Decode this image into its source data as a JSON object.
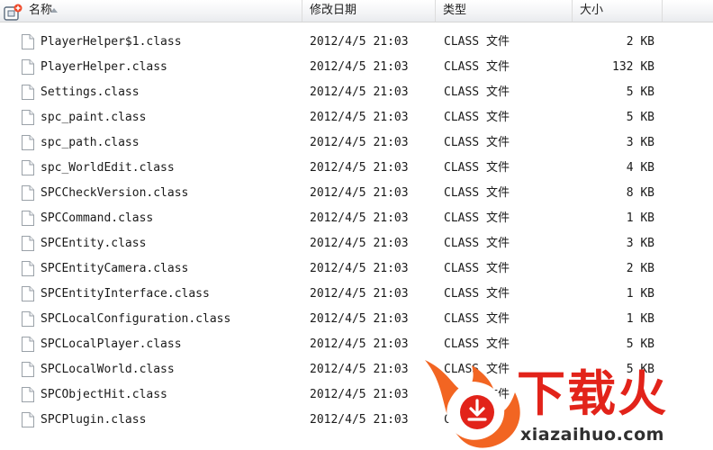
{
  "columns": {
    "name": "名称",
    "date": "修改日期",
    "type": "类型",
    "size": "大小"
  },
  "files": [
    {
      "name": "PlayerHelper$1.class",
      "date": "2012/4/5 21:03",
      "type": "CLASS 文件",
      "size": "2 KB"
    },
    {
      "name": "PlayerHelper.class",
      "date": "2012/4/5 21:03",
      "type": "CLASS 文件",
      "size": "132 KB"
    },
    {
      "name": "Settings.class",
      "date": "2012/4/5 21:03",
      "type": "CLASS 文件",
      "size": "5 KB"
    },
    {
      "name": "spc_paint.class",
      "date": "2012/4/5 21:03",
      "type": "CLASS 文件",
      "size": "5 KB"
    },
    {
      "name": "spc_path.class",
      "date": "2012/4/5 21:03",
      "type": "CLASS 文件",
      "size": "3 KB"
    },
    {
      "name": "spc_WorldEdit.class",
      "date": "2012/4/5 21:03",
      "type": "CLASS 文件",
      "size": "4 KB"
    },
    {
      "name": "SPCCheckVersion.class",
      "date": "2012/4/5 21:03",
      "type": "CLASS 文件",
      "size": "8 KB"
    },
    {
      "name": "SPCCommand.class",
      "date": "2012/4/5 21:03",
      "type": "CLASS 文件",
      "size": "1 KB"
    },
    {
      "name": "SPCEntity.class",
      "date": "2012/4/5 21:03",
      "type": "CLASS 文件",
      "size": "3 KB"
    },
    {
      "name": "SPCEntityCamera.class",
      "date": "2012/4/5 21:03",
      "type": "CLASS 文件",
      "size": "2 KB"
    },
    {
      "name": "SPCEntityInterface.class",
      "date": "2012/4/5 21:03",
      "type": "CLASS 文件",
      "size": "1 KB"
    },
    {
      "name": "SPCLocalConfiguration.class",
      "date": "2012/4/5 21:03",
      "type": "CLASS 文件",
      "size": "1 KB"
    },
    {
      "name": "SPCLocalPlayer.class",
      "date": "2012/4/5 21:03",
      "type": "CLASS 文件",
      "size": "5 KB"
    },
    {
      "name": "SPCLocalWorld.class",
      "date": "2012/4/5 21:03",
      "type": "CLASS 文件",
      "size": "5 KB"
    },
    {
      "name": "SPCObjectHit.class",
      "date": "2012/4/5 21:03",
      "type": "CLASS 文件",
      "size": ""
    },
    {
      "name": "SPCPlugin.class",
      "date": "2012/4/5 21:03",
      "type": "CLASS 文件",
      "size": ""
    }
  ],
  "watermark": {
    "logo_text": "下载火",
    "site": "xiazaihuo.com"
  },
  "icons": {
    "file": "file-icon",
    "app": "app-icon",
    "sort": "sort-ascending-icon"
  },
  "colors": {
    "watermark_orange": "#f26522",
    "watermark_red": "#e2231a"
  }
}
